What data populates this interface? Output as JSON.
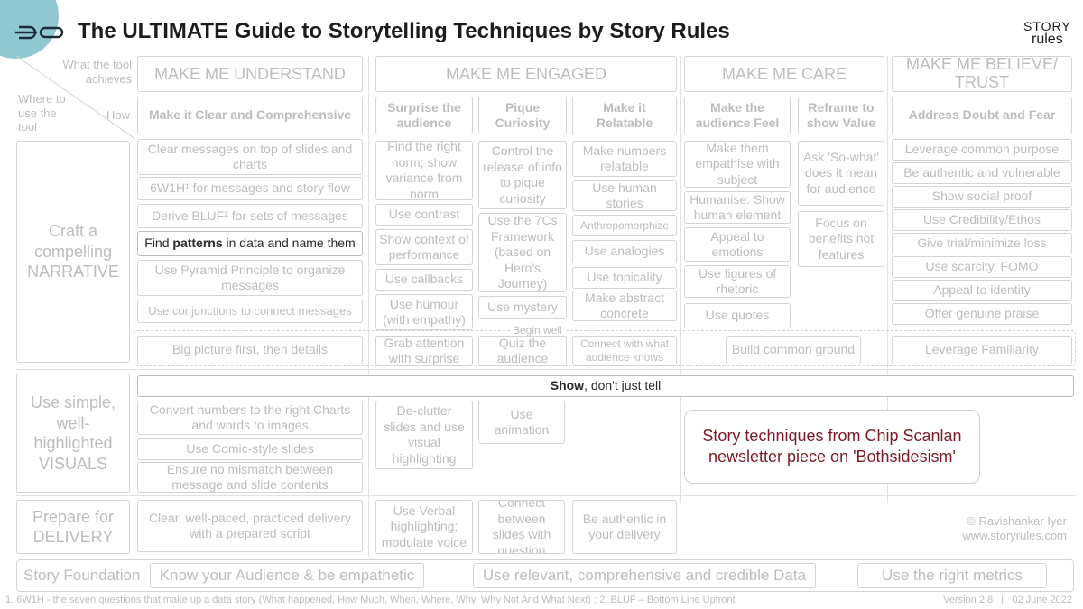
{
  "header": {
    "title": "The ULTIMATE Guide to Storytelling Techniques by Story Rules",
    "brand_top": "STORY",
    "brand_bottom": "rules"
  },
  "axis": {
    "what": "What the tool achieves",
    "where": "Where to use the tool",
    "how": "How"
  },
  "columns": {
    "understand": "MAKE ME UNDERSTAND",
    "engaged": "MAKE ME ENGAGED",
    "care": "MAKE ME CARE",
    "believe": "MAKE ME BELIEVE/ TRUST"
  },
  "subheaders": {
    "clear": "Make it Clear and Comprehensive",
    "surprise": "Surprise the audience",
    "curiosity": "Pique Curiosity",
    "relatable": "Make it Relatable",
    "feel": "Make the audience Feel",
    "reframe": "Reframe to show Value",
    "doubt": "Address Doubt and Fear"
  },
  "rows": {
    "narrative": "Craft a compelling NARRATIVE",
    "visuals": "Use simple, well-highlighted VISUALS",
    "delivery": "Prepare for DELIVERY",
    "foundation": "Story Foundation"
  },
  "cells": {
    "u1": "Clear messages on top of slides and charts",
    "u2": "6W1H¹ for messages and story flow",
    "u3": "Derive BLUF² for sets of messages",
    "u4_a": "Find ",
    "u4_b": "patterns",
    "u4_c": " in data and name them",
    "u5": "Use Pyramid Principle to organize messages",
    "u6": "Use conjunctions to connect messages",
    "s1": "Find the right norm; show variance from norm",
    "s2": "Use contrast",
    "s3": "Show context of performance",
    "s4": "Use callbacks",
    "s5": "Use humour (with empathy)",
    "c1": "Control the release of info to pique curiosity",
    "c2": "Use the 7Cs Framework (based on Hero's Journey)",
    "c3": "Use mystery",
    "r1": "Make numbers relatable",
    "r2": "Use human stories",
    "r3": "Anthropomorphize",
    "r4": "Use analogies",
    "r5": "Use topicality",
    "r6": "Make abstract concrete",
    "f1": "Make them empathise with subject",
    "f2": "Humanise: Show human element",
    "f3": "Appeal to emotions",
    "f4": "Use figures of rhetoric",
    "f5": "Use quotes",
    "v1": "Ask 'So-what' does it mean for audience",
    "v2": "Focus on benefits not features",
    "d1": "Leverage common purpose",
    "d2": "Be authentic and vulnerable",
    "d3": "Show social proof",
    "d4": "Use Credibility/Ethos",
    "d5": "Give trial/minimize loss",
    "d6": "Use scarcity, FOMO",
    "d7": "Appeal to identity",
    "d8": "Offer genuine praise",
    "begin_well": "Begin well",
    "b1": "Big picture first, then details",
    "b2": "Grab attention with surprise",
    "b3": "Quiz the audience",
    "b4": "Connect with what audience knows",
    "b5": "Build common ground",
    "b6": "Leverage Familiarity",
    "show_a": "Show",
    "show_b": ", don't just tell",
    "vis1": "Convert numbers to the right Charts and words to images",
    "vis2": "Use Comic-style slides",
    "vis3": "Ensure no mismatch between message and slide contents",
    "vis4": "De-clutter slides and use visual highlighting",
    "vis5": "Use animation",
    "callout": "Story techniques from Chip Scanlan newsletter piece on 'Bothsidesism'",
    "del1": "Clear, well-paced, practiced delivery with a prepared script",
    "del2": "Use Verbal highlighting; modulate voice",
    "del3": "Connect between slides with question",
    "del4": "Be authentic in your delivery",
    "credit1": "© Ravishankar Iyer",
    "credit2": "www.storyrules.com",
    "fd1": "Know your Audience & be empathetic",
    "fd2": "Use relevant, comprehensive and credible Data",
    "fd3": "Use the right metrics"
  },
  "footer": {
    "note": "1. 6W1H - the seven questions that make up a data story (What happened, How Much, When, Where, Why, Why Not And What Next) ; 2. BLUF – Bottom Line Upfront",
    "version": "Version 2.8   |   02 June 2022"
  },
  "colors": {
    "callout": "#7b1c25",
    "teal": "#8fc9cf",
    "title": "#1c1c1c",
    "muted": "#bdbdbd"
  }
}
